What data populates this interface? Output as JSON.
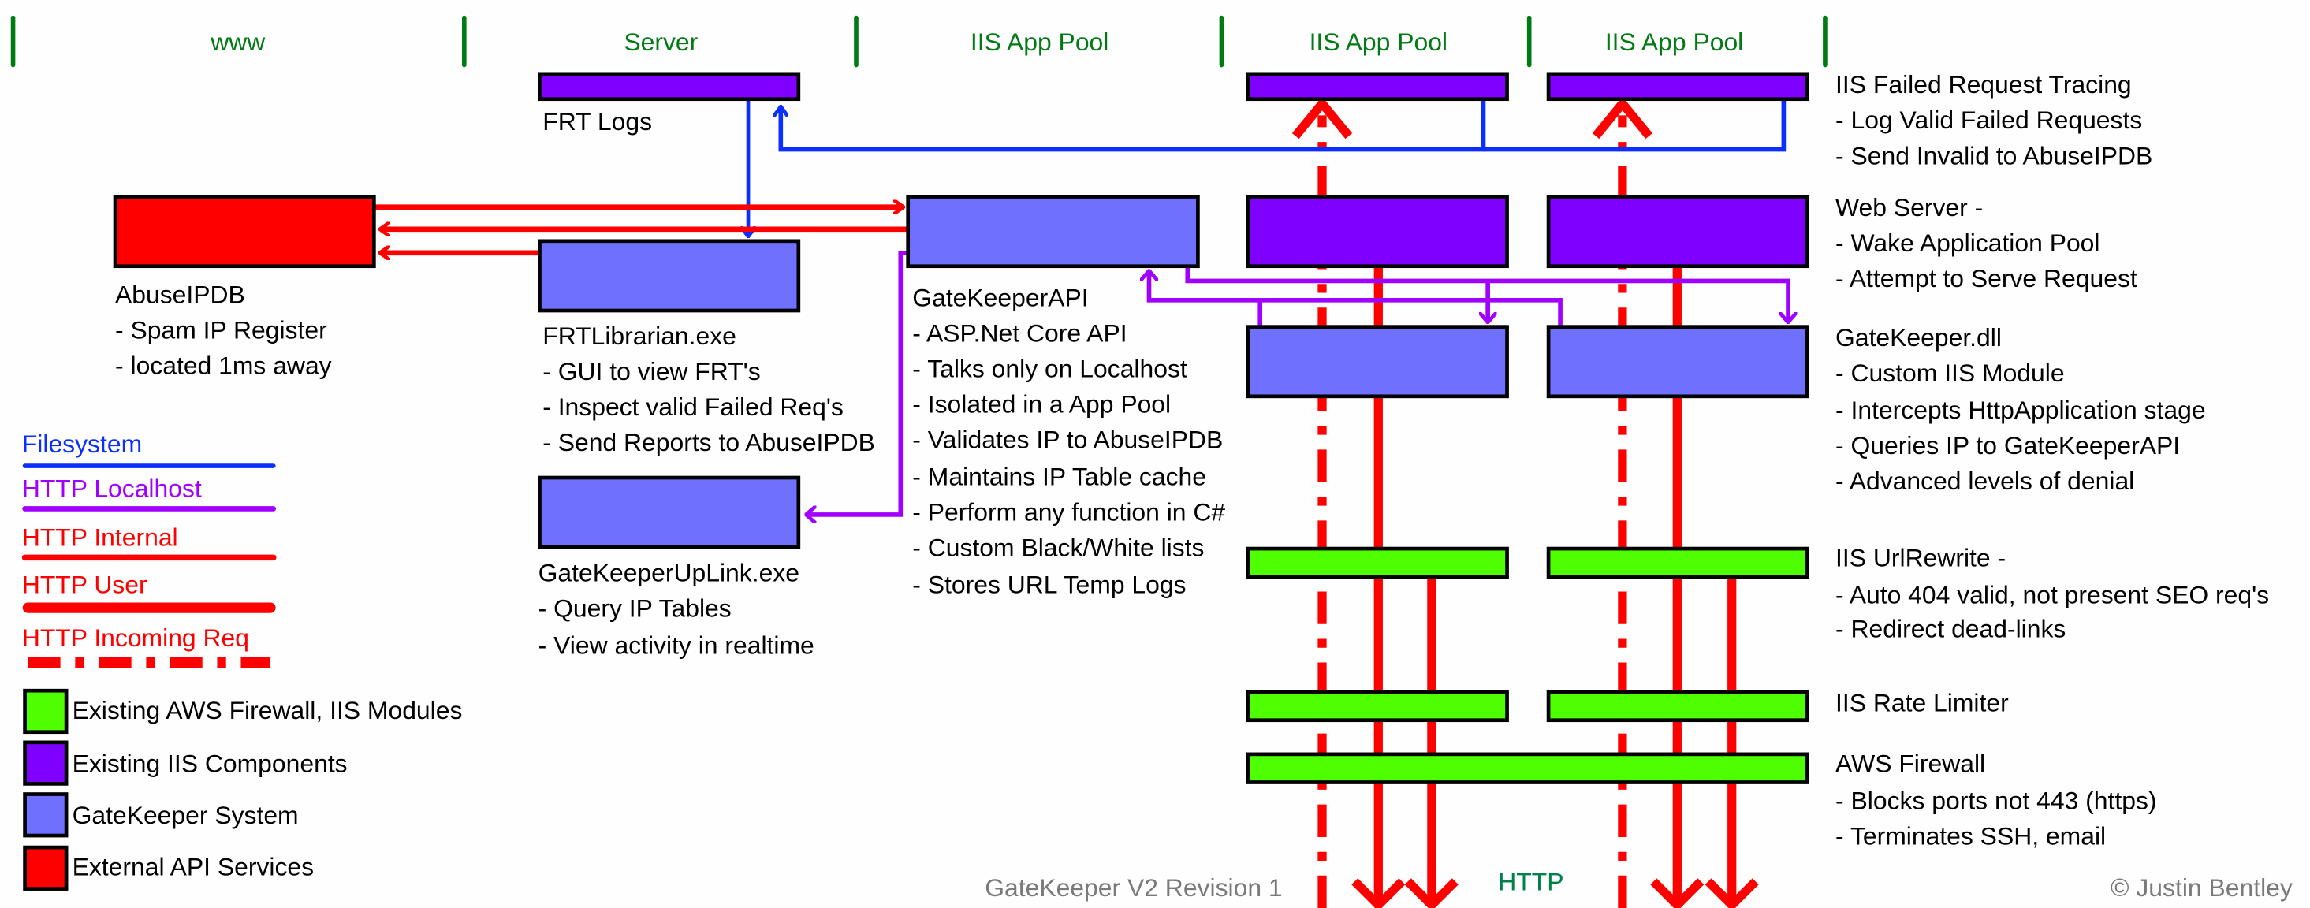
{
  "columns": [
    "www",
    "Server",
    "IIS App Pool",
    "IIS App Pool",
    "IIS App Pool"
  ],
  "colors": {
    "green_module": "#4dff00",
    "purple_iis": "#8000ff",
    "gatekeeper": "#7070ff",
    "external": "#ff0000",
    "filesystem_line": "#0a2fff",
    "localhost_line": "#a000ff",
    "http_line": "#ff0000",
    "column_text": "#007a12"
  },
  "nodes": {
    "frt_logs": {
      "title": "FRT Logs"
    },
    "abuseipdb": {
      "title": "AbuseIPDB",
      "lines": [
        "- Spam IP Register",
        "- located 1ms away"
      ]
    },
    "frtlibrarian": {
      "title": "FRTLibrarian.exe",
      "lines": [
        "- GUI to view FRT's",
        "- Inspect valid Failed Req's",
        "- Send Reports to AbuseIPDB"
      ]
    },
    "gatekeeperapi": {
      "title": "GateKeeperAPI",
      "lines": [
        "- ASP.Net Core API",
        "- Talks only on Localhost",
        "- Isolated in a App Pool",
        "- Validates IP to AbuseIPDB",
        "- Maintains IP Table cache",
        "- Perform any function in C#",
        "- Custom Black/White lists",
        "- Stores URL Temp Logs"
      ]
    },
    "uplink": {
      "title": "GateKeeperUpLink.exe",
      "lines": [
        "- Query IP Tables",
        "- View activity in realtime"
      ]
    }
  },
  "layers": [
    {
      "title": "IIS Failed Request Tracing",
      "lines": [
        "- Log Valid Failed Requests",
        "- Send Invalid to AbuseIPDB"
      ]
    },
    {
      "title": "Web Server -",
      "lines": [
        "- Wake Application Pool",
        "- Attempt to Serve Request"
      ]
    },
    {
      "title": "GateKeeper.dll",
      "lines": [
        "- Custom IIS Module",
        "- Intercepts HttpApplication stage",
        "- Queries IP to GateKeeperAPI",
        "- Advanced levels of denial"
      ]
    },
    {
      "title": "IIS UrlRewrite -",
      "lines": [
        "- Auto 404 valid, not present SEO req's",
        "- Redirect dead-links"
      ]
    },
    {
      "title": "IIS Rate Limiter",
      "lines": []
    },
    {
      "title": "AWS Firewall",
      "lines": [
        "- Blocks ports not 443 (https)",
        "- Terminates SSH, email"
      ]
    }
  ],
  "legend": {
    "lines": [
      {
        "label": "Filesystem",
        "color": "#0a2fff"
      },
      {
        "label": "HTTP Localhost",
        "color": "#a000ff"
      },
      {
        "label": "HTTP Internal",
        "color": "#ff0000"
      },
      {
        "label": "HTTP User",
        "color": "#ff0000"
      },
      {
        "label": "HTTP Incoming Req",
        "color": "#ff0000"
      }
    ],
    "boxes": [
      {
        "label": "Existing AWS Firewall, IIS Modules",
        "color": "#4dff00"
      },
      {
        "label": "Existing IIS Components",
        "color": "#8000ff"
      },
      {
        "label": "GateKeeper System",
        "color": "#7070ff"
      },
      {
        "label": "External API Services",
        "color": "#ff0000"
      }
    ]
  },
  "footer": {
    "revision": "GateKeeper V2 Revision 1",
    "http_label": "HTTP",
    "copyright": "© Justin Bentley"
  }
}
